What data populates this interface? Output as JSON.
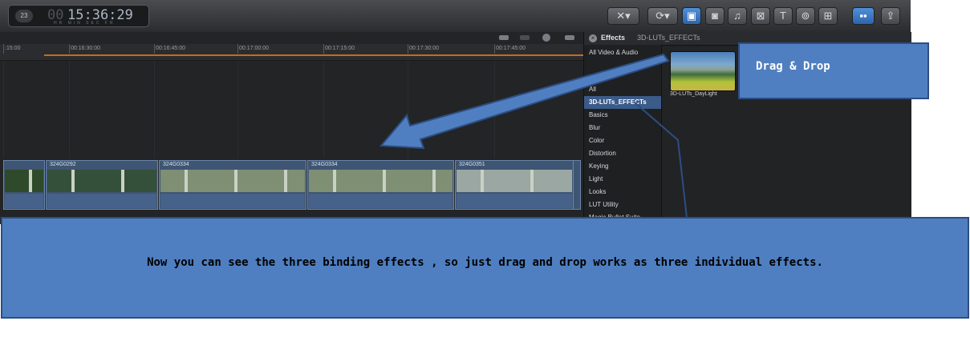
{
  "toolbar": {
    "timecode_badge": "23",
    "timecode_dim": "00",
    "timecode": "15:36:29",
    "timecode_units": "HR MIN SEC FR",
    "buttons": [
      {
        "name": "tool-select-button",
        "icon": "✕▾",
        "active": false
      },
      {
        "name": "retime-button",
        "icon": "⟳▾",
        "active": false
      },
      {
        "name": "effects-browser-button",
        "icon": "▣",
        "active": true
      },
      {
        "name": "photos-browser-button",
        "icon": "◙",
        "active": false
      },
      {
        "name": "music-browser-button",
        "icon": "♫",
        "active": false
      },
      {
        "name": "transitions-browser-button",
        "icon": "⊠",
        "active": false
      },
      {
        "name": "titles-browser-button",
        "icon": "T",
        "active": false
      },
      {
        "name": "generators-browser-button",
        "icon": "⊚",
        "active": false
      },
      {
        "name": "themes-browser-button",
        "icon": "⊞",
        "active": false
      },
      {
        "name": "background-tasks-button",
        "icon": "▪▪",
        "active": true
      },
      {
        "name": "share-button",
        "icon": "⇪",
        "active": false
      }
    ]
  },
  "timeline": {
    "ruler_ticks": [
      ":15:00",
      "00:16:30:00",
      "00:16:45:00",
      "00:17:00:00",
      "00:17:15:00",
      "00:17:30:00",
      "00:17:45:00"
    ],
    "clips": [
      {
        "title": "",
        "thumb_color": "#2f4a2a"
      },
      {
        "title": "324G0292",
        "thumb_color": "#34503a"
      },
      {
        "title": "324G0334",
        "thumb_color": "#7e8f74"
      },
      {
        "title": "324G0334",
        "thumb_color": "#7e8f74"
      },
      {
        "title": "324G0351",
        "thumb_color": "#9aa7a2"
      }
    ]
  },
  "effects_panel": {
    "title": "Effects",
    "subtitle": "3D-LUTs_EFFECTs",
    "categories": [
      {
        "label": "All Video & Audio",
        "selected": false
      },
      {
        "label": "All",
        "selected": false
      },
      {
        "label": "3D-LUTs_EFFECTs",
        "selected": true
      },
      {
        "label": "Basics",
        "selected": false
      },
      {
        "label": "Blur",
        "selected": false
      },
      {
        "label": "Color",
        "selected": false
      },
      {
        "label": "Distortion",
        "selected": false
      },
      {
        "label": "Keying",
        "selected": false
      },
      {
        "label": "Light",
        "selected": false
      },
      {
        "label": "Looks",
        "selected": false
      },
      {
        "label": "LUT Utility",
        "selected": false
      },
      {
        "label": "Magic Bullet Suite",
        "selected": false
      }
    ],
    "effect_item": "3D-LUTs_DayLight"
  },
  "callouts": {
    "drag_drop": "Drag & Drop",
    "note": "Now you can see the three binding effects , so just drag and drop works as three individual effects."
  },
  "colors": {
    "callout_fill": "#4f7fc1",
    "callout_border": "#2d4e83",
    "accent_orange": "#c56c1e",
    "selection_blue": "#3b5b89"
  }
}
